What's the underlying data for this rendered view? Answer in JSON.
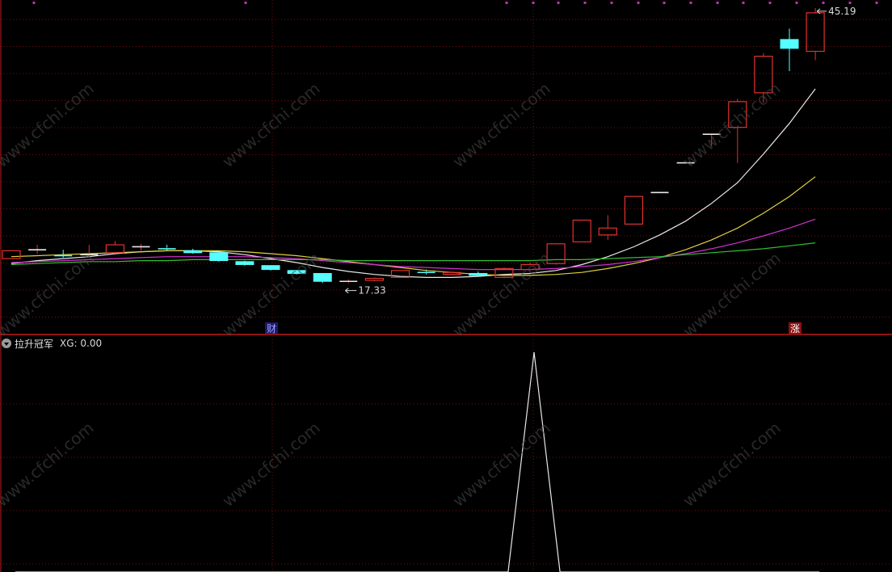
{
  "indicator": {
    "name": "拉升冠军",
    "value_label": "XG: 0.00"
  },
  "markers": {
    "finance_label": "财",
    "limit_up_label": "涨"
  },
  "watermark": {
    "text": "www.cfchi.com"
  },
  "colors": {
    "background": "#000000",
    "up_candle": "#e0322f",
    "down_candle": "#54ffff",
    "ma1": "#e8e8e8",
    "ma2": "#e0d040",
    "ma3": "#d030d0",
    "ma4": "#30c030",
    "grid": "#7a0e0e",
    "panel_divider": "#c01818",
    "indicator_line": "#e8e8e8",
    "top_dots": "#c030c0",
    "finance_marker_bg": "#1a1a6a",
    "finance_marker_text": "#a0a0ff",
    "limit_marker_bg": "#8a1010",
    "limit_marker_text": "#ffffff",
    "annotation_text": "#d8d8d8",
    "watermark": "#4a4a4a"
  },
  "chart_data": [
    {
      "type": "candlestick",
      "price_range": [
        12.2,
        46.0
      ],
      "high_label": "45.19",
      "low_label": "17.33",
      "candles": [
        {
          "o": 19.8,
          "h": 20.6,
          "l": 19.8,
          "c": 20.6
        },
        {
          "o": 20.7,
          "h": 21.2,
          "l": 20.3,
          "c": 20.7
        },
        {
          "o": 20.2,
          "h": 20.7,
          "l": 19.9,
          "c": 20.1
        },
        {
          "o": 20.2,
          "h": 21.2,
          "l": 20.0,
          "c": 20.2
        },
        {
          "o": 20.4,
          "h": 21.6,
          "l": 20.3,
          "c": 21.2
        },
        {
          "o": 21.0,
          "h": 21.3,
          "l": 20.6,
          "c": 21.0
        },
        {
          "o": 20.9,
          "h": 21.2,
          "l": 20.6,
          "c": 20.8
        },
        {
          "o": 20.6,
          "h": 20.8,
          "l": 20.3,
          "c": 20.4
        },
        {
          "o": 20.4,
          "h": 20.4,
          "l": 19.5,
          "c": 19.6
        },
        {
          "o": 19.5,
          "h": 19.6,
          "l": 19.1,
          "c": 19.2
        },
        {
          "o": 19.1,
          "h": 19.1,
          "l": 18.6,
          "c": 18.7
        },
        {
          "o": 18.6,
          "h": 18.6,
          "l": 18.2,
          "c": 18.3
        },
        {
          "o": 18.3,
          "h": 18.3,
          "l": 17.33,
          "c": 17.5
        },
        {
          "o": 17.4,
          "h": 17.7,
          "l": 17.3,
          "c": 17.5
        },
        {
          "o": 17.6,
          "h": 17.9,
          "l": 17.5,
          "c": 17.8
        },
        {
          "o": 17.9,
          "h": 18.6,
          "l": 17.9,
          "c": 18.6
        },
        {
          "o": 18.5,
          "h": 18.7,
          "l": 18.2,
          "c": 18.4
        },
        {
          "o": 18.2,
          "h": 18.5,
          "l": 18.2,
          "c": 18.4
        },
        {
          "o": 18.3,
          "h": 18.5,
          "l": 18.0,
          "c": 18.1
        },
        {
          "o": 17.9,
          "h": 18.9,
          "l": 17.8,
          "c": 18.8
        },
        {
          "o": 18.7,
          "h": 19.4,
          "l": 18.7,
          "c": 19.2
        },
        {
          "o": 19.3,
          "h": 21.3,
          "l": 19.2,
          "c": 21.3
        },
        {
          "o": 21.5,
          "h": 23.7,
          "l": 21.5,
          "c": 23.7
        },
        {
          "o": 22.2,
          "h": 24.2,
          "l": 21.7,
          "c": 22.9
        },
        {
          "o": 23.3,
          "h": 26.1,
          "l": 23.3,
          "c": 26.1
        },
        {
          "o": 26.5,
          "h": 26.5,
          "l": 26.5,
          "c": 26.5
        },
        {
          "o": 29.5,
          "h": 29.5,
          "l": 29.5,
          "c": 29.5
        },
        {
          "o": 32.3,
          "h": 32.3,
          "l": 31.2,
          "c": 32.4
        },
        {
          "o": 33.1,
          "h": 36.0,
          "l": 29.5,
          "c": 35.7
        },
        {
          "o": 36.6,
          "h": 40.6,
          "l": 35.6,
          "c": 40.3
        },
        {
          "o": 42.0,
          "h": 43.1,
          "l": 38.8,
          "c": 41.1
        },
        {
          "o": 40.8,
          "h": 45.19,
          "l": 39.9,
          "c": 44.7
        }
      ],
      "ma_series": [
        {
          "values": [
            19.3,
            19.6,
            19.8,
            20.0,
            20.3,
            20.5,
            20.6,
            20.6,
            20.5,
            20.2,
            19.8,
            19.4,
            18.9,
            18.5,
            18.2,
            18.0,
            17.9,
            17.9,
            18.0,
            18.2,
            18.3,
            18.6,
            19.2,
            20.0,
            21.0,
            22.2,
            23.6,
            25.4,
            27.5,
            30.4,
            33.5,
            37.0
          ]
        },
        {
          "values": [
            20.0,
            20.1,
            20.2,
            20.3,
            20.4,
            20.5,
            20.6,
            20.6,
            20.6,
            20.5,
            20.3,
            20.1,
            19.8,
            19.5,
            19.2,
            18.9,
            18.6,
            18.4,
            18.2,
            18.1,
            18.1,
            18.2,
            18.4,
            18.8,
            19.3,
            19.9,
            20.7,
            21.7,
            22.9,
            24.4,
            26.1,
            28.1
          ]
        },
        {
          "values": [
            19.4,
            19.5,
            19.6,
            19.7,
            19.8,
            19.9,
            20.0,
            20.0,
            20.0,
            20.0,
            19.9,
            19.8,
            19.6,
            19.4,
            19.2,
            19.0,
            18.9,
            18.8,
            18.7,
            18.7,
            18.7,
            18.8,
            19.0,
            19.2,
            19.5,
            19.9,
            20.3,
            20.8,
            21.4,
            22.1,
            22.9,
            23.8
          ]
        },
        {
          "values": [
            19.2,
            19.3,
            19.4,
            19.5,
            19.5,
            19.6,
            19.6,
            19.7,
            19.7,
            19.7,
            19.7,
            19.7,
            19.7,
            19.6,
            19.6,
            19.6,
            19.6,
            19.6,
            19.6,
            19.6,
            19.6,
            19.7,
            19.7,
            19.8,
            19.9,
            20.0,
            20.2,
            20.4,
            20.6,
            20.8,
            21.1,
            21.4
          ]
        }
      ]
    },
    {
      "type": "line",
      "x": [
        0,
        1,
        2,
        3,
        4,
        5,
        6,
        7,
        8,
        9,
        10,
        11,
        12,
        13,
        14,
        15,
        16,
        17,
        18,
        19,
        20,
        21,
        22,
        23,
        24,
        25,
        26,
        27,
        28,
        29,
        30,
        31
      ],
      "values": [
        0,
        0,
        0,
        0,
        0,
        0,
        0,
        0,
        0,
        0,
        0,
        0,
        0,
        0,
        0,
        0,
        0,
        0,
        0,
        0,
        1,
        0,
        0,
        0,
        0,
        0,
        0,
        0,
        0,
        0,
        0,
        0
      ],
      "ylim": [
        0,
        1
      ]
    }
  ]
}
